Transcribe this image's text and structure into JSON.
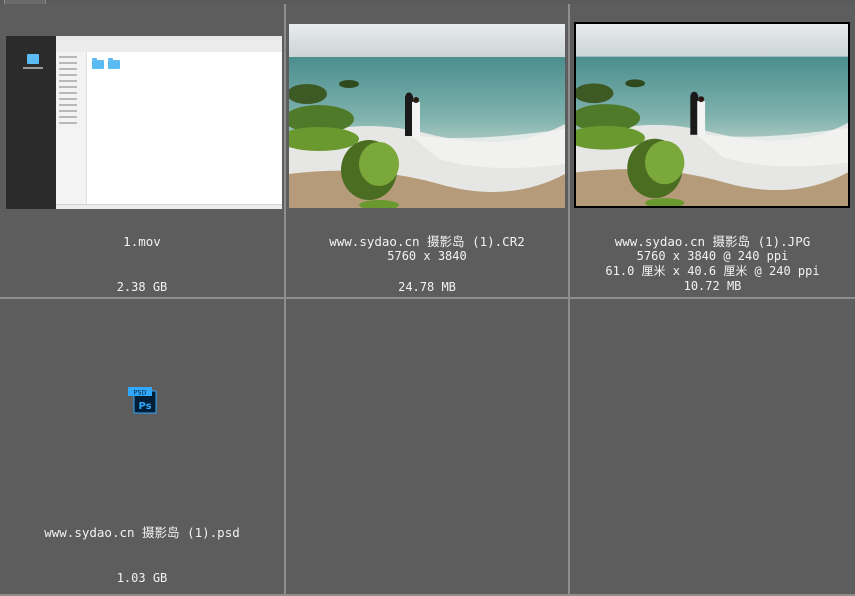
{
  "items": [
    {
      "name": "1.mov",
      "details": [],
      "size": "2.38 GB"
    },
    {
      "name": "www.sydao.cn 摄影岛 (1).CR2",
      "details": [
        "5760 x 3840"
      ],
      "size": "24.78 MB"
    },
    {
      "name": "www.sydao.cn 摄影岛 (1).JPG",
      "details": [
        "5760 x 3840 @ 240 ppi",
        "61.0 厘米 x 40.6 厘米 @ 240 ppi"
      ],
      "size": "10.72 MB"
    },
    {
      "name": "www.sydao.cn 摄影岛 (1).psd",
      "details": [],
      "size": "1.03 GB"
    }
  ],
  "ps_icon": {
    "badge": "PSD",
    "glyph": "Ps"
  },
  "colors": {
    "background": "#5d5d5d",
    "grid_line": "#8e8e8e",
    "text": "#f2f2f2",
    "ps_blue": "#31a8ff",
    "ps_dark": "#001e36"
  }
}
